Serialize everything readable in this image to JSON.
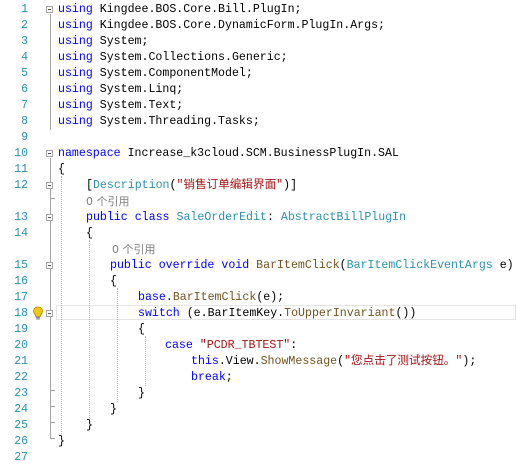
{
  "editor": {
    "line_numbers": [
      "1",
      "2",
      "3",
      "4",
      "5",
      "6",
      "7",
      "8",
      "9",
      "10",
      "11",
      "12",
      "13",
      "14",
      "15",
      "16",
      "17",
      "18",
      "19",
      "20",
      "21",
      "22",
      "23",
      "24",
      "25",
      "26",
      "27"
    ],
    "lines": {
      "l1": {
        "kw": "using",
        "rest": " Kingdee.BOS.Core.Bill.PlugIn;"
      },
      "l2": {
        "kw": "using",
        "rest": " Kingdee.BOS.Core.DynamicForm.PlugIn.Args;"
      },
      "l3": {
        "kw": "using",
        "rest": " System;"
      },
      "l4": {
        "kw": "using",
        "rest": " System.Collections.Generic;"
      },
      "l5": {
        "kw": "using",
        "rest": " System.ComponentModel;"
      },
      "l6": {
        "kw": "using",
        "rest": " System.Linq;"
      },
      "l7": {
        "kw": "using",
        "rest": " System.Text;"
      },
      "l8": {
        "kw": "using",
        "rest": " System.Threading.Tasks;"
      },
      "l10": {
        "kw": "namespace",
        "rest": " Increase_k3cloud.SCM.BusinessPlugIn.SAL"
      },
      "l11": {
        "brace": "{"
      },
      "l12": {
        "open": "[",
        "attr": "Description",
        "paren_open": "(",
        "str": "\"销售订单编辑界面\"",
        "close": ")]"
      },
      "lens12": "0 个引用",
      "l13": {
        "kw1": "public",
        "kw2": "class",
        "name": "SaleOrderEdit",
        "colon": ": ",
        "base": "AbstractBillPlugIn"
      },
      "l14": {
        "brace": "{"
      },
      "lens14": "0 个引用",
      "l15": {
        "kw1": "public",
        "kw2": "override",
        "kw3": "void",
        "method": "BarItemClick",
        "p_open": "(",
        "ptype": "BarItemClickEventArgs",
        "pname": " e)"
      },
      "l16": {
        "brace": "{"
      },
      "l17": {
        "kw": "base",
        "dot": ".",
        "method": "BarItemClick",
        "rest": "(e);"
      },
      "l18": {
        "kw": "switch",
        "pre": " (e.BarItemKey.",
        "method": "ToUpperInvariant",
        "rest": "())"
      },
      "l19": {
        "brace": "{"
      },
      "l20": {
        "kw": "case",
        "str": " \"PCDR_TBTEST\"",
        "rest": ":"
      },
      "l21": {
        "kw": "this",
        "mid": ".View.",
        "method": "ShowMessage",
        "p_open": "(",
        "str": "\"您点击了测试按钮。\"",
        "rest": ");"
      },
      "l22": {
        "kw": "break",
        "rest": ";"
      },
      "l23": {
        "brace": "}"
      },
      "l24": {
        "brace": "}"
      },
      "l25": {
        "brace": "}"
      },
      "l26": {
        "brace": "}"
      }
    },
    "colors": {
      "keyword": "#0000ff",
      "type": "#2b91af",
      "string": "#a31515",
      "method": "#74531f",
      "linenumber": "#2b91af"
    },
    "icons": {
      "lightbulb": "lightbulb-icon",
      "collapse": "collapse-toggle-icon"
    }
  }
}
